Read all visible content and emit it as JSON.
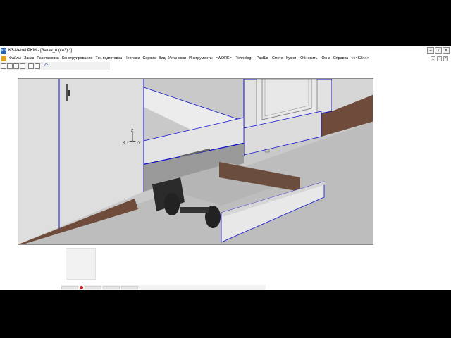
{
  "window": {
    "title": "К3-Mebel PKM - [Заказ_6 (ки3) *]",
    "app_icon": "K3"
  },
  "window_controls": {
    "minimize": "–",
    "restore": "▫",
    "close": "×"
  },
  "menu": {
    "items": [
      "Файлы",
      "Заказ",
      "Расстановка",
      "Конструирование",
      "Тех.подготовка",
      "Чертежи",
      "Сервис",
      "Вид",
      "Установки",
      "Инструменты",
      "=WORK=",
      "-Tehnolog-",
      "-РазШк-",
      "Смета",
      "Кухни",
      "-Обновить-",
      "Окна",
      "Справка",
      "<<<K3>>>"
    ],
    "right_controls": [
      "_",
      "▫",
      "×"
    ]
  },
  "toolbar": {
    "icons": [
      "new-doc-icon",
      "open-folder-icon",
      "print-icon",
      "save-icon",
      "print-preview-icon",
      "properties-icon",
      "undo-icon"
    ],
    "undo_glyph": "↶"
  },
  "axis": {
    "z": "Z",
    "y": "Y",
    "x": "X"
  },
  "colors": {
    "canvas_bg": "#c9c9c9",
    "panel_light": "#e6e6e6",
    "panel_mid": "#d6d6d6",
    "edge_blue": "#1010d0",
    "wood": "#6e4b3a",
    "drawer_dark": "#2a2a2a"
  }
}
